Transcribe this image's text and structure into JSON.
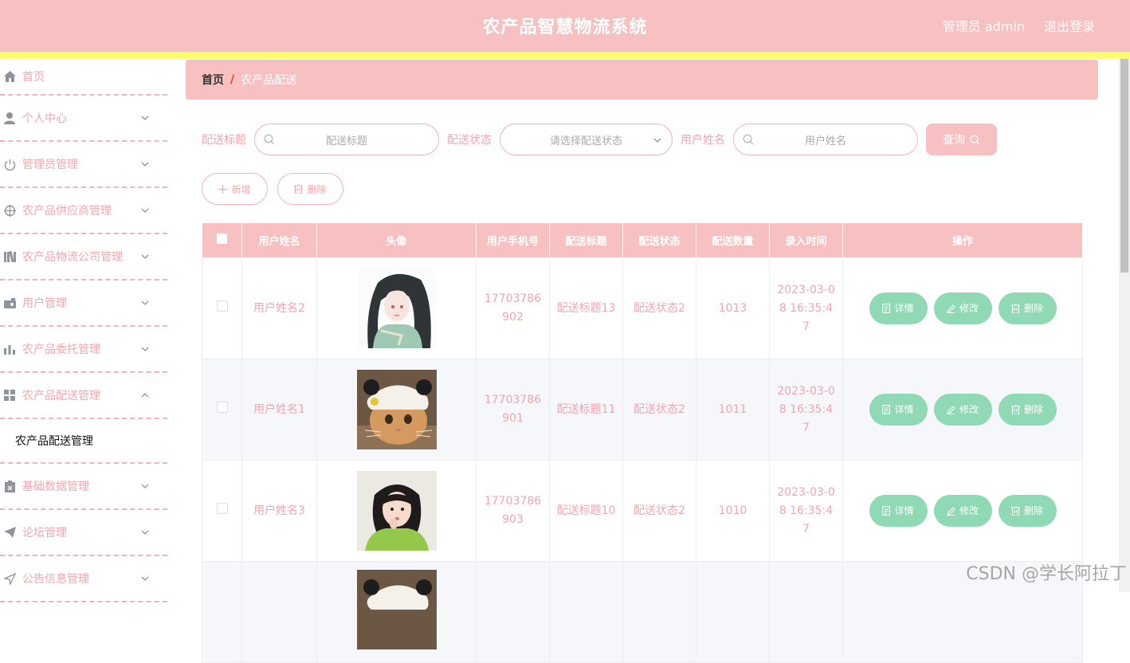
{
  "header": {
    "title": "农产品智慧物流系统",
    "user": "管理员 admin",
    "logout": "退出登录"
  },
  "sidebar": {
    "items": [
      {
        "label": "首页",
        "icon": "home-icon"
      },
      {
        "label": "个人中心",
        "icon": "user-icon"
      },
      {
        "label": "管理员管理",
        "icon": "power-icon"
      },
      {
        "label": "农产品供应商管理",
        "icon": "crosshair-icon"
      },
      {
        "label": "农产品物流公司管理",
        "icon": "library-icon"
      },
      {
        "label": "用户管理",
        "icon": "camera-icon"
      },
      {
        "label": "农产品委托管理",
        "icon": "bar-chart-icon"
      },
      {
        "label": "农产品配送管理",
        "icon": "grid-icon"
      },
      {
        "label": "基础数据管理",
        "icon": "clipboard-icon"
      },
      {
        "label": "论坛管理",
        "icon": "paper-plane-icon"
      },
      {
        "label": "公告信息管理",
        "icon": "location-arrow-icon"
      }
    ],
    "submenu": {
      "label": "农产品配送管理"
    }
  },
  "breadcrumb": {
    "home": "首页",
    "separator": "/",
    "current": "农产品配送"
  },
  "search": {
    "title_label": "配送标题",
    "title_placeholder": "配送标题",
    "status_label": "配送状态",
    "status_placeholder": "请选择配送状态",
    "user_label": "用户姓名",
    "user_placeholder": "用户姓名",
    "query_button": "查询"
  },
  "actions": {
    "add": "新增",
    "delete": "删除"
  },
  "table": {
    "headers": [
      "用户姓名",
      "头像",
      "用户手机号",
      "配送标题",
      "配送状态",
      "配送数量",
      "录入时间",
      "操作"
    ],
    "rows": [
      {
        "name": "用户姓名2",
        "avatar": "avatar-girl-illustration",
        "phone": "17703786902",
        "title": "配送标题13",
        "status": "配送状态2",
        "qty": "1013",
        "time": "2023-03-08 16:35:47"
      },
      {
        "name": "用户姓名1",
        "avatar": "avatar-cat-hat",
        "phone": "17703786901",
        "title": "配送标题11",
        "status": "配送状态2",
        "qty": "1011",
        "time": "2023-03-08 16:35:47"
      },
      {
        "name": "用户姓名3",
        "avatar": "avatar-girl-photo",
        "phone": "17703786903",
        "title": "配送标题10",
        "status": "配送状态2",
        "qty": "1010",
        "time": "2023-03-08 16:35:47"
      }
    ],
    "ops": {
      "detail": "详情",
      "edit": "修改",
      "delete": "删除"
    }
  },
  "watermark": "CSDN @学长阿拉丁",
  "colors": {
    "primary": "#f7c1c1",
    "accent_bar": "#ffff66",
    "op_button": "#8fd9b4",
    "text_pink": "#f3a5ad"
  }
}
